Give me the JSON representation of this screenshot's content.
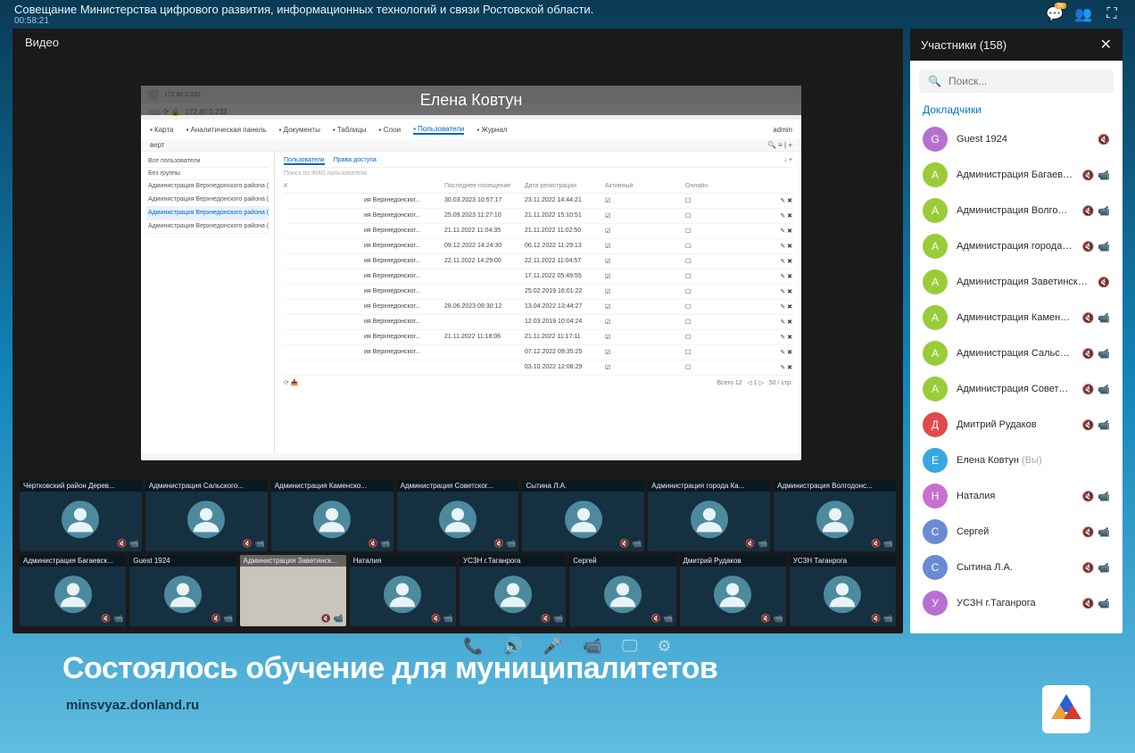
{
  "header": {
    "title": "Совещание Министерства цифрового развития, информационных технологий и связи Ростовской области.",
    "duration": "00:58:21",
    "chat_badge": "3x"
  },
  "video": {
    "label": "Видео",
    "presenter_name": "Елена Ковтун",
    "browser": {
      "url": "172.80.0.232",
      "nav": [
        "Карта",
        "Аналитическая панель",
        "Документы",
        "Таблицы",
        "Слои",
        "Пользователи",
        "Журнал"
      ],
      "user": "admin",
      "side_header": "верт",
      "side_items": [
        "Все пользователи",
        "Без группы",
        "Администрация Верхнедонского района (администра...",
        "Администрация Верхнедонского района (пользовател...",
        "Администрация Верхнедонского района (пользовател...",
        "Администрация Верхнедонского района (руководител..."
      ],
      "side_selected": 4,
      "main_tabs": [
        "Пользователи",
        "Права доступа"
      ],
      "columns": [
        "#",
        "",
        "Последнее посещение",
        "Дата регистрации",
        "Активный",
        "Онлайн",
        ""
      ],
      "rows": [
        [
          "ия Верхнедонског...",
          "30.03.2023 10:57:17",
          "23.11.2022 14:44:21",
          "☑",
          "☐",
          "✎ ✖"
        ],
        [
          "ия Верхнедонског...",
          "25.09.2023 11:27:10",
          "21.11.2022 15:10:51",
          "☑",
          "☐",
          "✎ ✖"
        ],
        [
          "ия Верхнедонског...",
          "21.11.2022 11:04:35",
          "21.11.2022 11:02:50",
          "☑",
          "☐",
          "✎ ✖"
        ],
        [
          "ия Верхнедонског...",
          "09.12.2022 14:24:30",
          "06.12.2022 11:29:13",
          "☑",
          "☐",
          "✎ ✖"
        ],
        [
          "ия Верхнедонског...",
          "22.11.2022 14:29:00",
          "22.11.2022 11:04:57",
          "☑",
          "☐",
          "✎ ✖"
        ],
        [
          "ия Верхнедонског...",
          "",
          "17.11.2022 05:49:55",
          "☑",
          "☐",
          "✎ ✖"
        ],
        [
          "ия Верхнедонског...",
          "",
          "25.02.2019 16:01:22",
          "☑",
          "☐",
          "✎ ✖"
        ],
        [
          "ия Верхнедонског...",
          "28.06.2023 09:30:12",
          "13.04.2022 13:44:27",
          "☑",
          "☐",
          "✎ ✖"
        ],
        [
          "ия Верхнедонског...",
          "",
          "12.03.2019 10:04:24",
          "☑",
          "☐",
          "✎ ✖"
        ],
        [
          "ия Верхнедонског...",
          "21.11.2022 11:18:06",
          "21.11.2022 11:17:11",
          "☑",
          "☐",
          "✎ ✖"
        ],
        [
          "ия Верхнедонског...",
          "",
          "07.12.2022 09:35:25",
          "☑",
          "☐",
          "✎ ✖"
        ],
        [
          "",
          "",
          "03.10.2022 12:08:29",
          "☑",
          "☐",
          "✎ ✖"
        ]
      ],
      "footer_left": "Всего 12",
      "footer_right": "50 / стр."
    }
  },
  "tiles": [
    [
      "Чертковский район Дерев...",
      "Администрация Сальского...",
      "Администрация Каменско...",
      "Администрация Советског...",
      "Сытина Л.А.",
      "Администрация города Ка...",
      "Администрация Волгодонс..."
    ],
    [
      "Администрация Багаевск...",
      "Guest 1924",
      "Администрация Заветинск...",
      "Наталия",
      "УСЗН г.Таганрога",
      "Сергей",
      "Дмитрий Рудаков",
      "УСЗН Таганрога"
    ]
  ],
  "tile_special": {
    "row": 1,
    "col": 2
  },
  "sidebar": {
    "title": "Участники (158)",
    "search_placeholder": "Поиск...",
    "section": "Докладчики",
    "participants": [
      {
        "letter": "G",
        "color": "#b770d1",
        "name": "Guest 1924",
        "you": false,
        "mic": true,
        "cam": false
      },
      {
        "letter": "А",
        "color": "#9acc3a",
        "name": "Администрация Багаевск...",
        "you": false,
        "mic": true,
        "cam": true
      },
      {
        "letter": "А",
        "color": "#9acc3a",
        "name": "Администрация Волгодон...",
        "you": false,
        "mic": true,
        "cam": true
      },
      {
        "letter": "А",
        "color": "#9acc3a",
        "name": "Администрация города Ка...",
        "you": false,
        "mic": true,
        "cam": true
      },
      {
        "letter": "А",
        "color": "#9acc3a",
        "name": "Администрация Заветинского...",
        "you": false,
        "mic": true,
        "cam": false
      },
      {
        "letter": "А",
        "color": "#9acc3a",
        "name": "Администрация Каменско...",
        "you": false,
        "mic": true,
        "cam": true
      },
      {
        "letter": "А",
        "color": "#9acc3a",
        "name": "Администрация Сальског...",
        "you": false,
        "mic": true,
        "cam": true
      },
      {
        "letter": "А",
        "color": "#9acc3a",
        "name": "Администрация Советского р...",
        "you": false,
        "mic": true,
        "cam": true
      },
      {
        "letter": "Д",
        "color": "#e14a4a",
        "name": "Дмитрий Рудаков",
        "you": false,
        "mic": true,
        "cam": true
      },
      {
        "letter": "Е",
        "color": "#3aa6e0",
        "name": "Елена Ковтун",
        "you": true,
        "mic": false,
        "cam": false
      },
      {
        "letter": "Н",
        "color": "#c770d1",
        "name": "Наталия",
        "you": false,
        "mic": true,
        "cam": true
      },
      {
        "letter": "С",
        "color": "#6a8bd4",
        "name": "Сергей",
        "you": false,
        "mic": true,
        "cam": true
      },
      {
        "letter": "С",
        "color": "#6a8bd4",
        "name": "Сытина Л.А.",
        "you": false,
        "mic": true,
        "cam": true
      },
      {
        "letter": "У",
        "color": "#b770d1",
        "name": "УСЗН г.Таганрога",
        "you": false,
        "mic": true,
        "cam": true
      }
    ],
    "you_label": "(Вы)"
  },
  "footer": {
    "headline": "Состоялось обучение для муниципалитетов",
    "url": "minsvyaz.donland.ru"
  }
}
